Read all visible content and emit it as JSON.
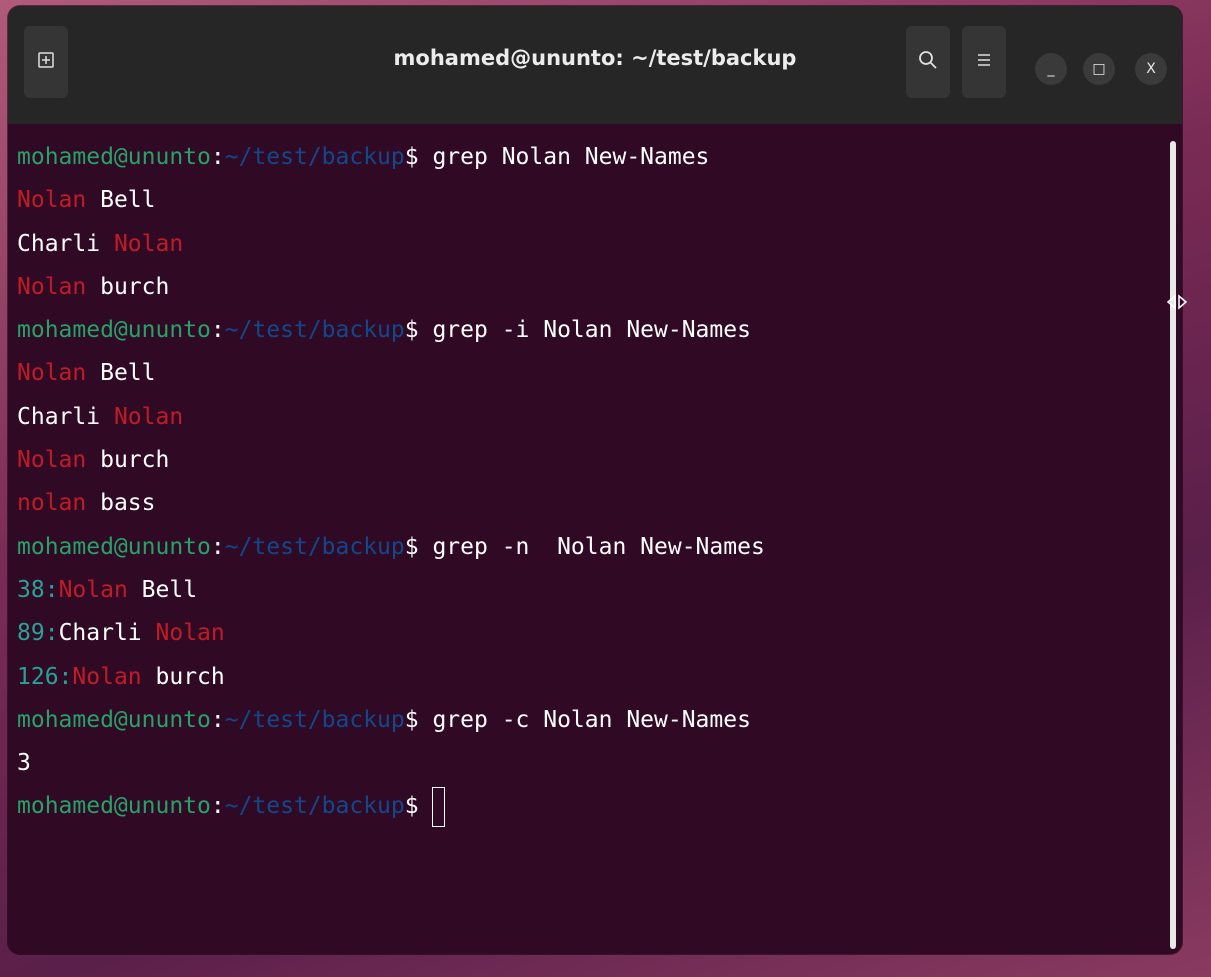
{
  "window": {
    "title": "mohamed@ununto: ~/test/backup",
    "buttons": {
      "new_tab_icon": "new-tab-icon",
      "search_icon": "search-icon",
      "menu_icon": "hamburger-menu-icon",
      "minimize_label": "_",
      "maximize_label": "□",
      "close_label": "X"
    }
  },
  "prompt": {
    "user": "mohamed@ununto",
    "sep": ":",
    "path": "~/test/backup",
    "dollar": "$ "
  },
  "terminal": {
    "cmd1": "grep Nolan New-Names",
    "out1": [
      {
        "a": "Nolan",
        "b": " Bell"
      },
      {
        "a": "Charli ",
        "b": "Nolan"
      },
      {
        "a": "Nolan",
        "b": " burch"
      }
    ],
    "cmd2": "grep -i Nolan New-Names",
    "out2": [
      {
        "a": "Nolan",
        "b": " Bell"
      },
      {
        "a": "Charli ",
        "b": "Nolan"
      },
      {
        "a": "Nolan",
        "b": " burch"
      },
      {
        "a": "nolan",
        "b": " bass"
      }
    ],
    "cmd3": "grep -n  Nolan New-Names",
    "out3": [
      {
        "num": "38",
        "colon": ":",
        "a": "Nolan",
        "b": " Bell"
      },
      {
        "num": "89",
        "colon": ":",
        "a": "Charli ",
        "b": "Nolan"
      },
      {
        "num": "126",
        "colon": ":",
        "a": "Nolan",
        "b": " burch"
      }
    ],
    "cmd4": "grep -c Nolan New-Names",
    "out4": "3"
  },
  "colors": {
    "background": "#300a24",
    "headerbar": "#262626",
    "user": "#26a269",
    "path": "#12488b",
    "match": "#c01c28",
    "line_number": "#2aa198",
    "text": "#ffffff"
  }
}
